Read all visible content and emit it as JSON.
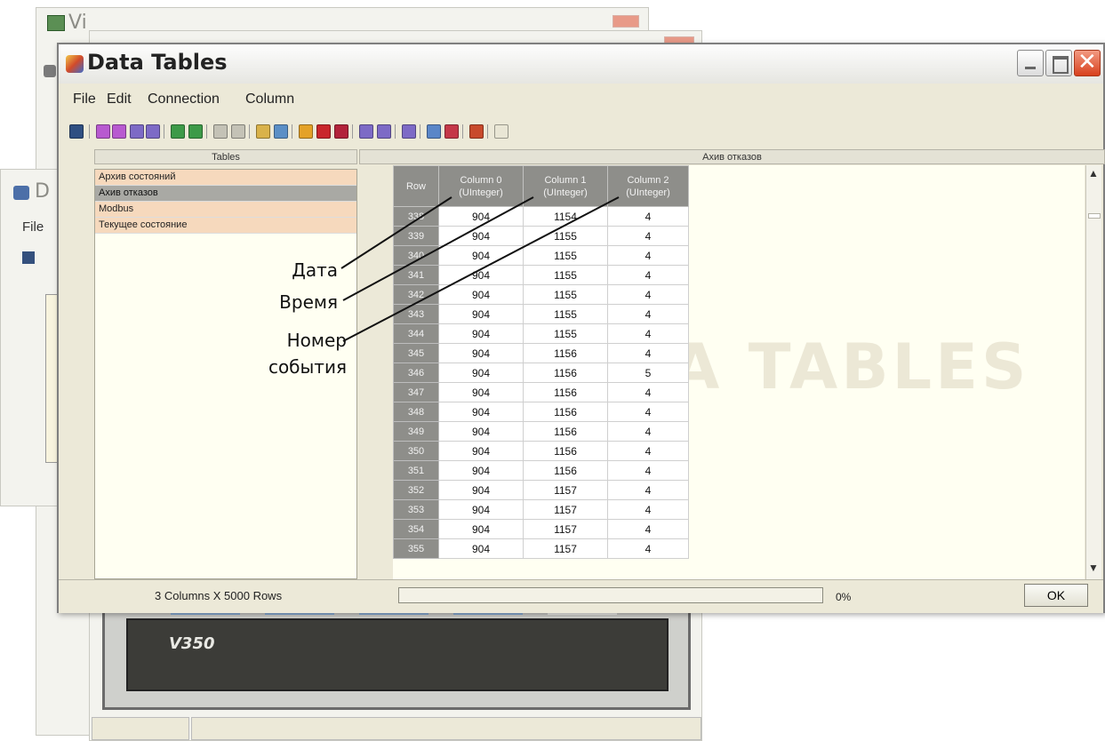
{
  "background": {
    "window_title_1": "Vi",
    "window_title_2": "D",
    "file_menu": "File",
    "device_label": "V350"
  },
  "window": {
    "title": "Data Tables",
    "menu": [
      "File",
      "Edit",
      "Connection",
      "Column"
    ]
  },
  "left_panel": {
    "header": "Tables",
    "items": [
      "Архив состояний",
      "Ахив отказов",
      "Modbus",
      "Текущее состояние"
    ],
    "selected_index": 1
  },
  "grid": {
    "header": "Ахив отказов",
    "watermark": "DATA TABLES",
    "columns": [
      {
        "label": "Row",
        "type": ""
      },
      {
        "label": "Column 0",
        "type": "(UInteger)"
      },
      {
        "label": "Column 1",
        "type": "(UInteger)"
      },
      {
        "label": "Column 2",
        "type": "(UInteger)"
      }
    ],
    "rows": [
      [
        "338",
        "904",
        "1154",
        "4"
      ],
      [
        "339",
        "904",
        "1155",
        "4"
      ],
      [
        "340",
        "904",
        "1155",
        "4"
      ],
      [
        "341",
        "904",
        "1155",
        "4"
      ],
      [
        "342",
        "904",
        "1155",
        "4"
      ],
      [
        "343",
        "904",
        "1155",
        "4"
      ],
      [
        "344",
        "904",
        "1155",
        "4"
      ],
      [
        "345",
        "904",
        "1156",
        "4"
      ],
      [
        "346",
        "904",
        "1156",
        "5"
      ],
      [
        "347",
        "904",
        "1156",
        "4"
      ],
      [
        "348",
        "904",
        "1156",
        "4"
      ],
      [
        "349",
        "904",
        "1156",
        "4"
      ],
      [
        "350",
        "904",
        "1156",
        "4"
      ],
      [
        "351",
        "904",
        "1156",
        "4"
      ],
      [
        "352",
        "904",
        "1157",
        "4"
      ],
      [
        "353",
        "904",
        "1157",
        "4"
      ],
      [
        "354",
        "904",
        "1157",
        "4"
      ],
      [
        "355",
        "904",
        "1157",
        "4"
      ]
    ]
  },
  "status": {
    "summary": "3 Columns X 5000 Rows",
    "progress_text": "0%",
    "progress": 0,
    "ok_label": "OK"
  },
  "annotations": [
    "Дата",
    "Время",
    "Номер события"
  ],
  "colors": {
    "selection": "#a9a9a4",
    "list_item": "#f6d9bd",
    "close_button": "#d8401d"
  }
}
